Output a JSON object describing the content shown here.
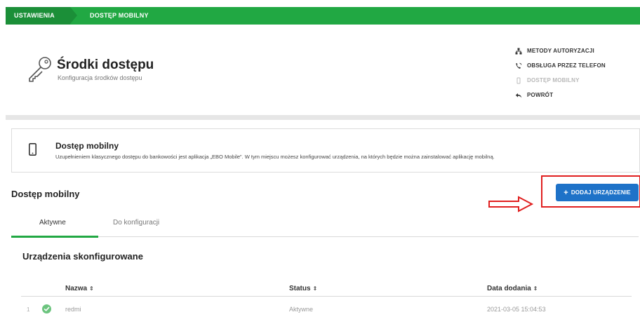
{
  "breadcrumb": {
    "items": [
      "USTAWIENIA",
      "DOSTĘP MOBILNY"
    ]
  },
  "header": {
    "title": "Środki dostępu",
    "subtitle": "Konfiguracja środków dostępu"
  },
  "side_links": [
    {
      "label": "METODY AUTORYZACJI",
      "icon": "sitemap-icon",
      "disabled": false
    },
    {
      "label": "OBSŁUGA PRZEZ TELEFON",
      "icon": "phone-call-icon",
      "disabled": false
    },
    {
      "label": "DOSTĘP MOBILNY",
      "icon": "mobile-icon",
      "disabled": true
    },
    {
      "label": "POWRÓT",
      "icon": "back-arrow-icon",
      "disabled": false
    }
  ],
  "info": {
    "title": "Dostęp mobilny",
    "description": "Uzupełnieniem klasycznego dostępu do bankowości jest aplikacja „EBO Mobile”. W tym miejscu możesz konfigurować urządzenia, na których będzie można zainstalować aplikację mobilną."
  },
  "section": {
    "title": "Dostęp mobilny",
    "add_button": "+ DODAJ URZĄDZENIE",
    "add_button_label": "DODAJ URZĄDZENIE"
  },
  "tabs": [
    {
      "label": "Aktywne",
      "active": true
    },
    {
      "label": "Do konfiguracji",
      "active": false
    }
  ],
  "subsection": {
    "title": "Urządzenia skonfigurowane"
  },
  "table": {
    "columns": [
      {
        "label": "Nazwa",
        "sort_icon": "⇕"
      },
      {
        "label": "Status",
        "sort_icon": "⇕"
      },
      {
        "label": "Data dodania",
        "sort_icon": "⇕"
      }
    ],
    "rows": [
      {
        "index": "1",
        "name": "redmi",
        "status": "Aktywne",
        "date": "2021-03-05 15:04:53"
      }
    ]
  },
  "colors": {
    "brand_green": "#21a843",
    "button_blue": "#1e72c8",
    "annotation_red": "#e01f1f"
  }
}
